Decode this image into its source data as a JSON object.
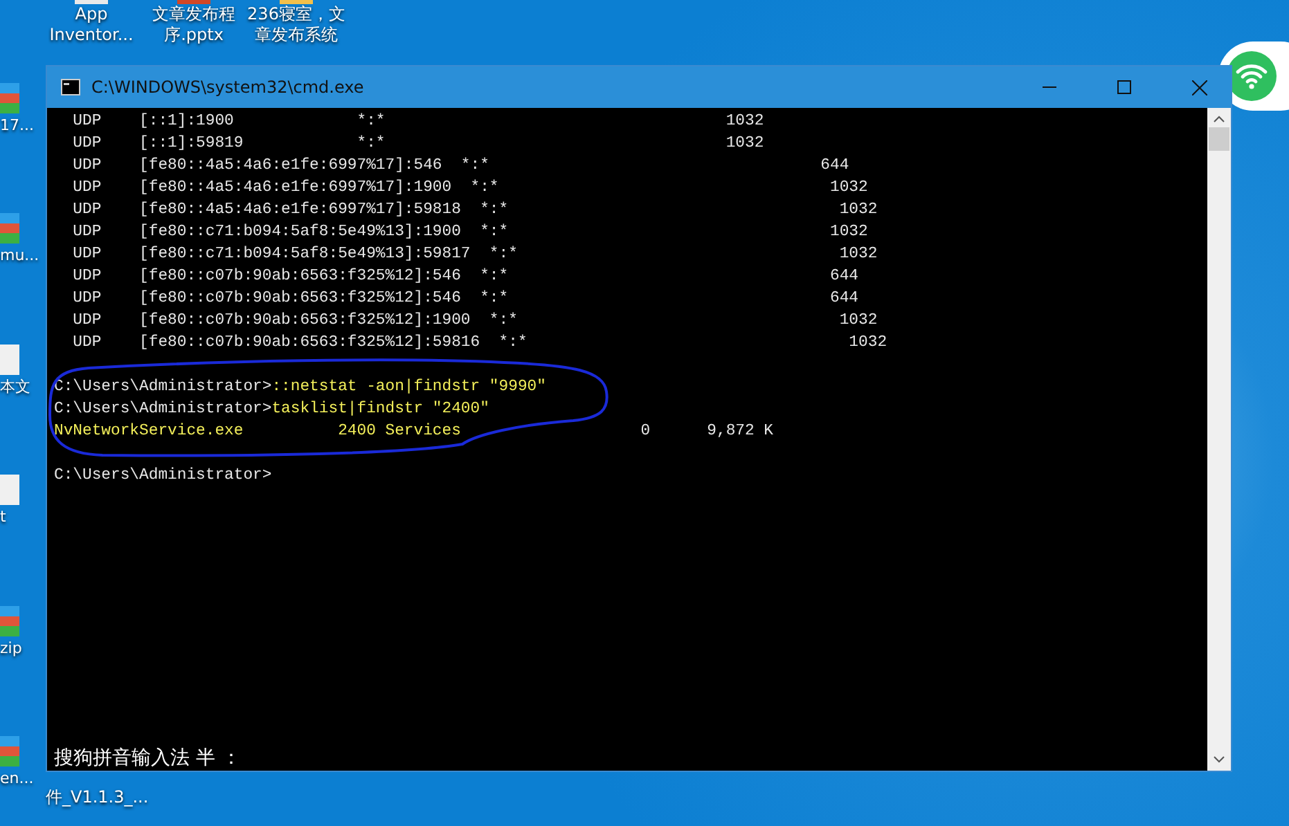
{
  "desktop": {
    "icons": [
      {
        "label": "App Inventor...",
        "kind": "app"
      },
      {
        "label": "文章发布程序.pptx",
        "kind": "pptx"
      },
      {
        "label": "236寝室，文章发布系统",
        "kind": "folder"
      }
    ],
    "edge_labels": [
      {
        "label": "17...",
        "kind": "archive"
      },
      {
        "label": "mu...",
        "kind": "archive"
      },
      {
        "label": "本文",
        "kind": "text"
      },
      {
        "label": "t",
        "kind": "text"
      },
      {
        "label": "zip",
        "kind": "archive"
      },
      {
        "label": "en...",
        "kind": "archive"
      }
    ],
    "bottom_label": "件_V1.1.3_..."
  },
  "window": {
    "title": "C:\\WINDOWS\\system32\\cmd.exe",
    "lines": [
      {
        "kind": "text",
        "segments": [
          {
            "text": "  UDP    [::1]:1900             *:*                                    1032",
            "highlight": false
          }
        ]
      },
      {
        "kind": "text",
        "segments": [
          {
            "text": "  UDP    [::1]:59819            *:*                                    1032",
            "highlight": false
          }
        ]
      },
      {
        "kind": "text",
        "segments": [
          {
            "text": "  UDP    [fe80::4a5:4a6:e1fe:6997%17]:546  *:*                                   644",
            "highlight": false
          }
        ]
      },
      {
        "kind": "text",
        "segments": [
          {
            "text": "  UDP    [fe80::4a5:4a6:e1fe:6997%17]:1900  *:*                                   1032",
            "highlight": false
          }
        ]
      },
      {
        "kind": "text",
        "segments": [
          {
            "text": "  UDP    [fe80::4a5:4a6:e1fe:6997%17]:59818  *:*                                   1032",
            "highlight": false
          }
        ]
      },
      {
        "kind": "text",
        "segments": [
          {
            "text": "  UDP    [fe80::c71:b094:5af8:5e49%13]:1900  *:*                                  1032",
            "highlight": false
          }
        ]
      },
      {
        "kind": "text",
        "segments": [
          {
            "text": "  UDP    [fe80::c71:b094:5af8:5e49%13]:59817  *:*                                  1032",
            "highlight": false
          }
        ]
      },
      {
        "kind": "text",
        "segments": [
          {
            "text": "  UDP    [fe80::c07b:90ab:6563:f325%12]:546  *:*                                  644",
            "highlight": false
          }
        ]
      },
      {
        "kind": "text",
        "segments": [
          {
            "text": "  UDP    [fe80::c07b:90ab:6563:f325%12]:546  *:*                                  644",
            "highlight": false
          }
        ]
      },
      {
        "kind": "text",
        "segments": [
          {
            "text": "  UDP    [fe80::c07b:90ab:6563:f325%12]:1900  *:*                                  1032",
            "highlight": false
          }
        ]
      },
      {
        "kind": "text",
        "segments": [
          {
            "text": "  UDP    [fe80::c07b:90ab:6563:f325%12]:59816  *:*                                  1032",
            "highlight": false
          }
        ]
      },
      {
        "kind": "blank"
      },
      {
        "kind": "text",
        "segments": [
          {
            "text": "C:\\Users\\Administrator>",
            "highlight": false
          },
          {
            "text": "::netstat -aon|findstr \"9990\"",
            "highlight": true
          }
        ]
      },
      {
        "kind": "text",
        "segments": [
          {
            "text": "C:\\Users\\Administrator>",
            "highlight": false
          },
          {
            "text": "tasklist|findstr \"2400\"",
            "highlight": true
          }
        ]
      },
      {
        "kind": "text",
        "segments": [
          {
            "text": "NvNetworkService.exe          2400 Services",
            "highlight": true
          },
          {
            "text": "                   0      9,872 K",
            "highlight": false
          }
        ]
      },
      {
        "kind": "blank"
      },
      {
        "kind": "text",
        "segments": [
          {
            "text": "C:\\Users\\Administrator>",
            "highlight": false
          }
        ]
      }
    ],
    "ime_status": "搜狗拼音输入法 半 ："
  }
}
